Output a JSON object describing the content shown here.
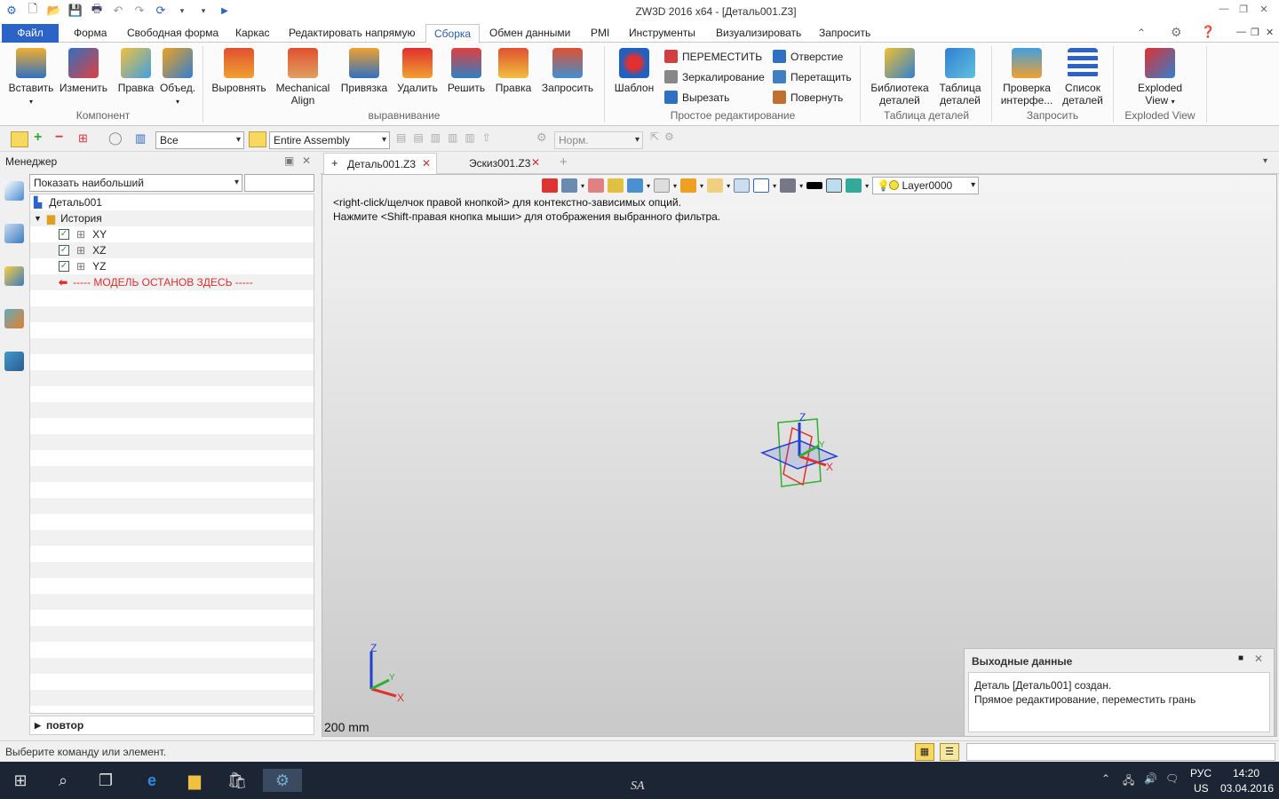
{
  "app": {
    "title": "ZW3D 2016  x64 - [Деталь001.Z3]"
  },
  "ribbon_tabs": [
    {
      "label": "Файл"
    },
    {
      "label": "Форма"
    },
    {
      "label": "Свободная форма"
    },
    {
      "label": "Каркас"
    },
    {
      "label": "Редактировать напрямую"
    },
    {
      "label": "Сборка"
    },
    {
      "label": "Обмен данными"
    },
    {
      "label": "PMI"
    },
    {
      "label": "Инструменты"
    },
    {
      "label": "Визуализировать"
    },
    {
      "label": "Запросить"
    }
  ],
  "ribbon": {
    "component": {
      "group": "Компонент",
      "insert": "Вставить",
      "modify": "Изменить",
      "edit": "Правка",
      "merge": "Объед."
    },
    "align": {
      "group": "выравнивание",
      "align": "Выровнять",
      "mech_align_1": "Mechanical",
      "mech_align_2": "Align",
      "snap": "Привязка",
      "delete": "Удалить",
      "solve": "Решить",
      "edit": "Правка",
      "query": "Запросить"
    },
    "simple_edit": {
      "group": "Простое редактирование",
      "template": "Шаблон",
      "move": "ПЕРЕМЕСТИТЬ",
      "mirror": "Зеркалирование",
      "cut": "Вырезать",
      "hole": "Отверстие",
      "drag": "Перетащить",
      "rotate": "Повернуть"
    },
    "part_table": {
      "group": "Таблица деталей",
      "library_1": "Библиотека",
      "library_2": "деталей",
      "table_1": "Таблица",
      "table_2": "деталей"
    },
    "query": {
      "group": "Запросить",
      "interf_1": "Проверка",
      "interf_2": "интерфе...",
      "list_1": "Список",
      "list_2": "деталей"
    },
    "exploded": {
      "group": "Exploded View",
      "btn_1": "Exploded",
      "btn_2": "View"
    }
  },
  "toolbar2": {
    "filter": "Все",
    "scope": "Entire Assembly",
    "style": "Норм."
  },
  "manager": {
    "title": "Менеджер",
    "show_combo": "Показать наибольший",
    "tree": [
      {
        "label": "Деталь001"
      },
      {
        "label": "История"
      },
      {
        "label": "XY"
      },
      {
        "label": "XZ"
      },
      {
        "label": "YZ"
      },
      {
        "label": "----- МОДЕЛЬ ОСТАНОВ ЗДЕСЬ -----"
      }
    ],
    "repeat": "повтор"
  },
  "doc_tabs": [
    {
      "label": "Деталь001.Z3"
    },
    {
      "label": "Эскиз001.Z3"
    }
  ],
  "viewport": {
    "layer": "Layer0000",
    "msg1": "<right-click/щелчок правой кнопкой> для контекстно-зависимых опций.",
    "msg2": "Нажмите <Shift-правая кнопка мыши> для отображения выбранного фильтра.",
    "scale": "200 mm",
    "axis_x": "X",
    "axis_y": "Y",
    "axis_z": "Z"
  },
  "output": {
    "title": "Выходные данные",
    "line1": "Деталь [Деталь001] создан.",
    "line2": "Прямое редактирование, переместить грань"
  },
  "status": {
    "text": "Выберите команду или элемент."
  },
  "taskbar": {
    "lang": "РУС",
    "layout": "US",
    "time": "14:20",
    "date": "03.04.2016",
    "watermark": "SA"
  },
  "colors": {
    "accent": "#2b63c6",
    "warning_red": "#d83030",
    "axis_x": "#e03030",
    "axis_y": "#30b030",
    "axis_z": "#2040d0"
  }
}
